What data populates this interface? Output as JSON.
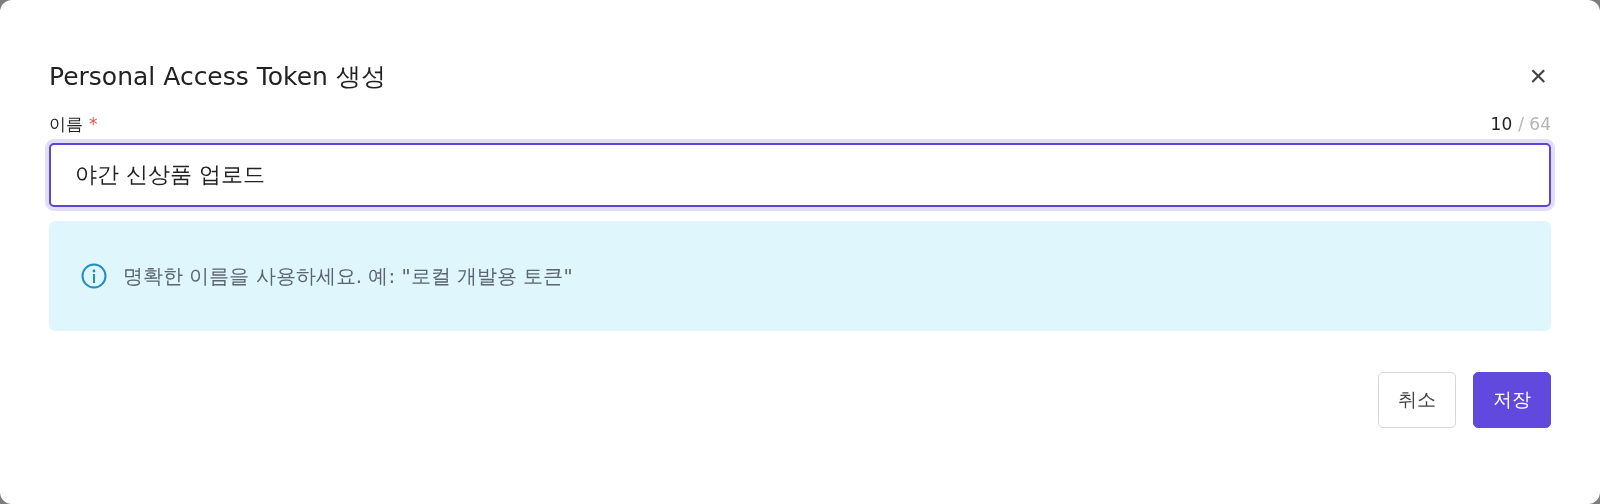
{
  "dialog": {
    "title": "Personal Access Token 생성",
    "close": "×"
  },
  "name_field": {
    "label": "이름",
    "required": true,
    "required_mark": "*",
    "count": "10",
    "limit": "/ 64",
    "value": "야간 신상품 업로드",
    "focused": true
  },
  "info": {
    "text": "명확한 이름을 사용하세요. 예: \"로컬 개발용 토큰\""
  },
  "buttons": [
    {
      "label": "취소",
      "kind": "secondary"
    },
    {
      "label": "저장",
      "kind": "primary"
    }
  ]
}
